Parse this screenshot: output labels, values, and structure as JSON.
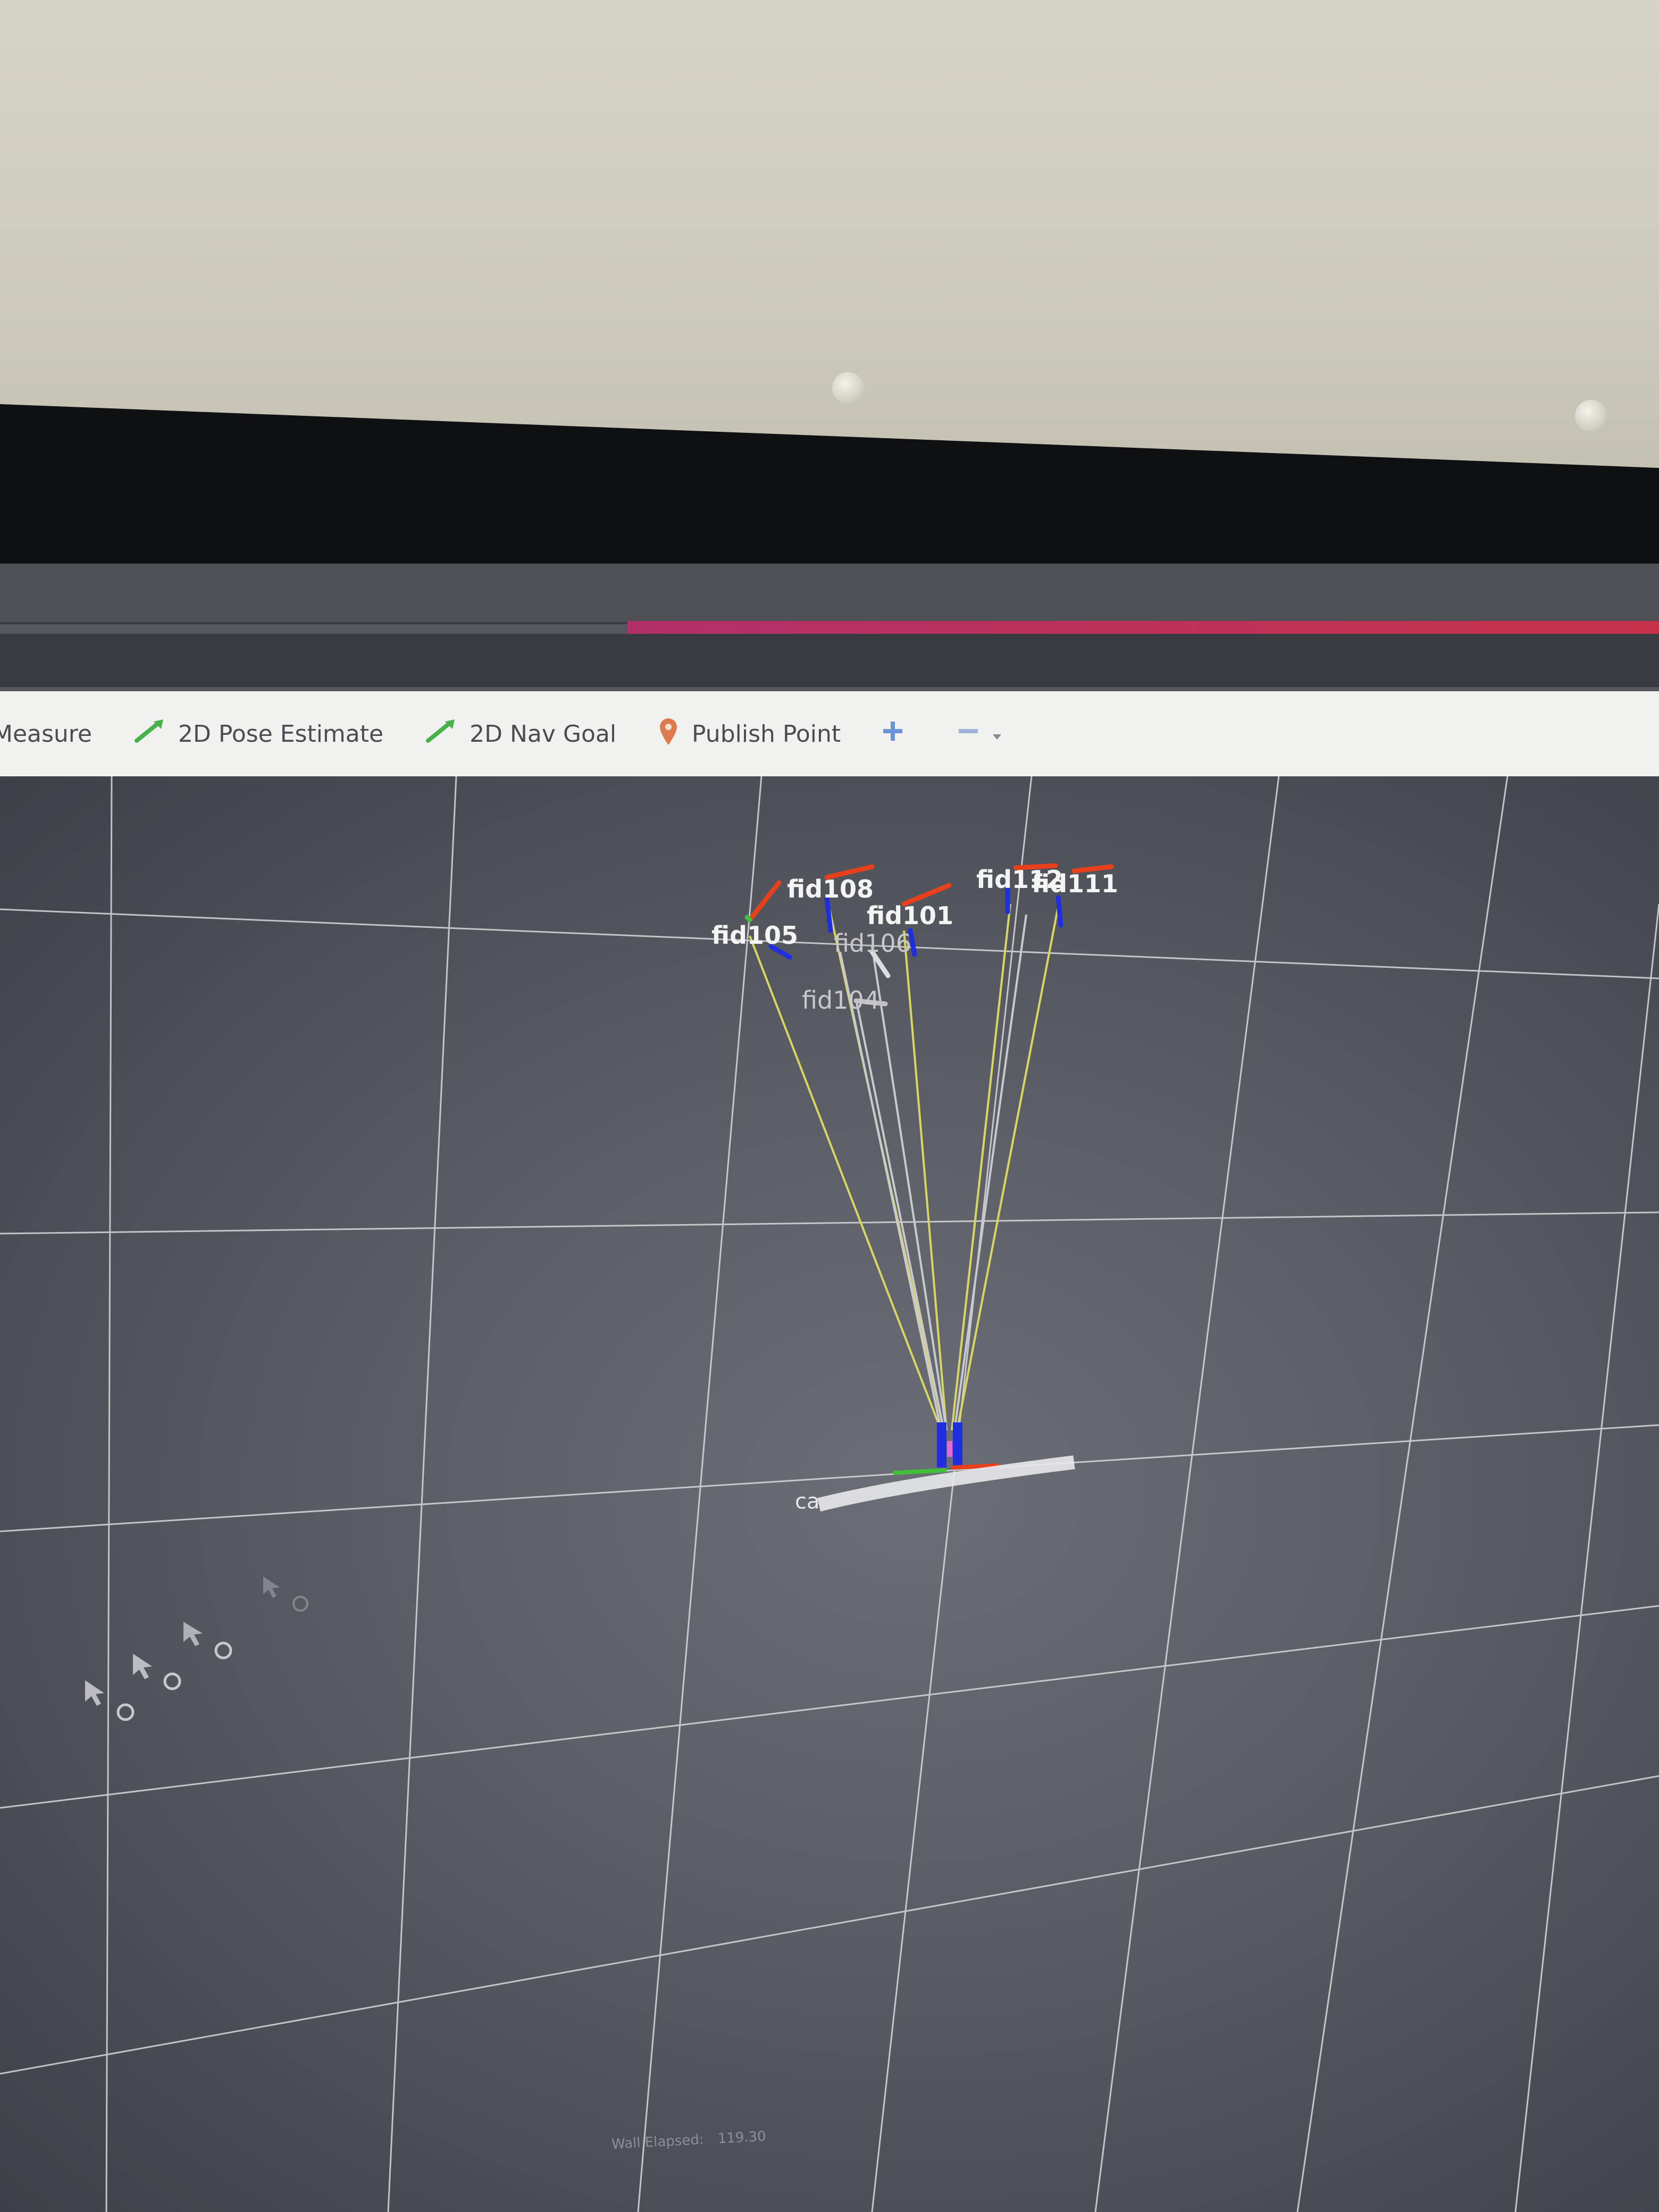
{
  "toolbar": {
    "items": [
      {
        "label": "Measure",
        "icon": "ruler-icon"
      },
      {
        "label": "2D Pose Estimate",
        "icon": "green-arrow-icon"
      },
      {
        "label": "2D Nav Goal",
        "icon": "green-arrow-icon"
      },
      {
        "label": "Publish Point",
        "icon": "map-pin-icon"
      }
    ],
    "add_icon": "plus-icon",
    "remove_icon": "minus-icon",
    "dropdown_icon": "chevron-down-icon"
  },
  "scene": {
    "markers": [
      "fid108",
      "fid105",
      "fid101",
      "fid106",
      "fid104",
      "fid112",
      "fid111"
    ],
    "camera_label": "ca",
    "colors": {
      "grid": "#d8d8dc",
      "ray_yellow": "#d8d663",
      "ray_white": "#c9cacf",
      "axis_x": "#e8401c",
      "axis_y": "#3fbf3a",
      "axis_z": "#1f2fe0"
    }
  },
  "statusbar": {
    "wall_elapsed_label": "Wall Elapsed:",
    "wall_elapsed_value": "119.30"
  }
}
